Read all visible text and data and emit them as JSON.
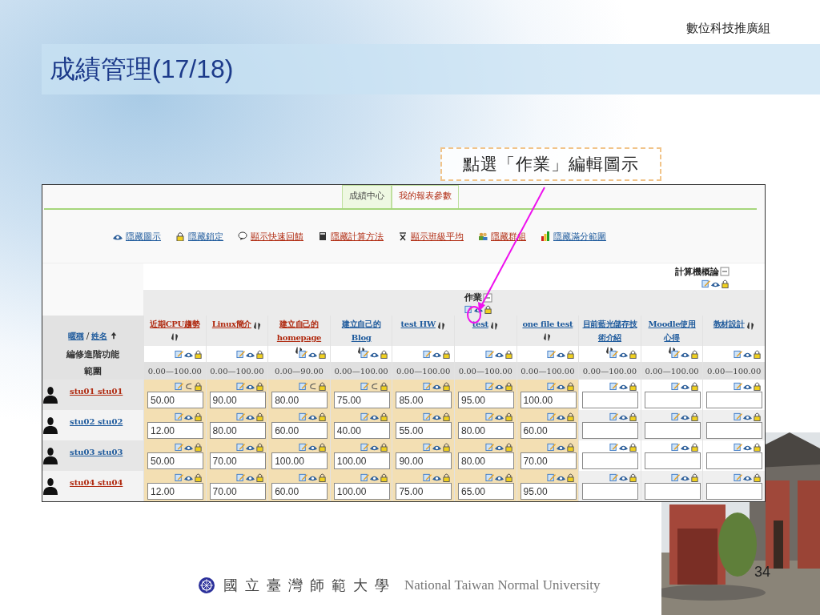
{
  "header": {
    "organization": "數位科技推廣組",
    "title": "成績管理(17/18)"
  },
  "callout": {
    "text": "點選「作業」編輯圖示"
  },
  "gradebook": {
    "tabs": [
      {
        "label": "成績中心",
        "selected": true
      },
      {
        "label": "我的報表參數",
        "selected": false
      }
    ],
    "toolbar": [
      {
        "label": "隱藏圖示",
        "visited": false
      },
      {
        "label": "隱藏鎖定",
        "visited": false
      },
      {
        "label": "顯示快速回饋",
        "visited": true
      },
      {
        "label": "隱藏計算方法",
        "visited": true
      },
      {
        "label": "顯示班級平均",
        "visited": true
      },
      {
        "label": "隱藏群組",
        "visited": true
      },
      {
        "label": "隱藏滿分範圍",
        "visited": false
      }
    ],
    "category_rows": [
      {
        "name": "計算機概論",
        "kind": "course"
      },
      {
        "name": "作業",
        "kind": "category"
      }
    ],
    "name_header": {
      "first": "暱稱",
      "separator": "/",
      "second": "姓名"
    },
    "columns": [
      {
        "name": "近期CPU趨勢",
        "visited": true,
        "highlighted": true,
        "range": "0.00—100.00"
      },
      {
        "name": "Linux簡介",
        "visited": true,
        "highlighted": true,
        "range": "0.00—100.00"
      },
      {
        "name": "建立自己的homepage",
        "visited": true,
        "highlighted": true,
        "range": "0.00—90.00"
      },
      {
        "name": "建立自己的Blog",
        "visited": false,
        "highlighted": true,
        "range": "0.00—100.00"
      },
      {
        "name": "test HW",
        "visited": false,
        "highlighted": true,
        "range": "0.00—100.00"
      },
      {
        "name": "test",
        "visited": false,
        "highlighted": true,
        "range": "0.00—100.00"
      },
      {
        "name": "one file test",
        "visited": false,
        "highlighted": true,
        "range": "0.00—100.00"
      },
      {
        "name": "目前藍光儲存技術介紹",
        "visited": false,
        "highlighted": false,
        "range": "0.00—100.00"
      },
      {
        "name": "Moodle使用心得",
        "visited": false,
        "highlighted": false,
        "range": "0.00—100.00"
      },
      {
        "name": "教材設計",
        "visited": false,
        "highlighted": false,
        "range": "0.00—100.00"
      }
    ],
    "edit_row_label": "編修進階功能",
    "range_row_label": "範圍",
    "students": [
      {
        "name": "stu01 stu01",
        "visited": true,
        "grades": [
          {
            "value": "50.00",
            "hidden": true
          },
          {
            "value": "90.00",
            "hidden": false
          },
          {
            "value": "80.00",
            "hidden": true
          },
          {
            "value": "75.00",
            "hidden": true
          },
          {
            "value": "85.00",
            "hidden": false
          },
          {
            "value": "95.00",
            "hidden": false
          },
          {
            "value": "100.00",
            "hidden": false
          },
          {
            "hidden": false
          },
          {
            "hidden": false
          },
          {
            "hidden": false
          }
        ]
      },
      {
        "name": "stu02 stu02",
        "visited": false,
        "grades": [
          {
            "value": "12.00",
            "hidden": false
          },
          {
            "value": "80.00",
            "hidden": false
          },
          {
            "value": "60.00",
            "hidden": false
          },
          {
            "value": "40.00",
            "hidden": false
          },
          {
            "value": "55.00",
            "hidden": false
          },
          {
            "value": "80.00",
            "hidden": false
          },
          {
            "value": "60.00",
            "hidden": false
          },
          {
            "hidden": false
          },
          {
            "hidden": false
          },
          {
            "hidden": false
          }
        ]
      },
      {
        "name": "stu03 stu03",
        "visited": false,
        "grades": [
          {
            "value": "50.00",
            "hidden": false
          },
          {
            "value": "70.00",
            "hidden": false
          },
          {
            "value": "100.00",
            "hidden": false
          },
          {
            "value": "100.00",
            "hidden": false
          },
          {
            "value": "90.00",
            "hidden": false
          },
          {
            "value": "80.00",
            "hidden": false
          },
          {
            "value": "70.00",
            "hidden": false
          },
          {
            "hidden": false
          },
          {
            "hidden": false
          },
          {
            "hidden": false
          }
        ]
      },
      {
        "name": "stu04 stu04",
        "visited": true,
        "grades": [
          {
            "value": "12.00",
            "hidden": false
          },
          {
            "value": "70.00",
            "hidden": false
          },
          {
            "value": "60.00",
            "hidden": false
          },
          {
            "value": "100.00",
            "hidden": false
          },
          {
            "value": "75.00",
            "hidden": false
          },
          {
            "value": "65.00",
            "hidden": false
          },
          {
            "value": "95.00",
            "hidden": false
          },
          {
            "hidden": false
          },
          {
            "hidden": false
          },
          {
            "hidden": false
          }
        ]
      }
    ]
  },
  "footer": {
    "university_chinese": "國立臺灣師範大學",
    "university_english": "National Taiwan Normal University",
    "page_number": "34"
  }
}
